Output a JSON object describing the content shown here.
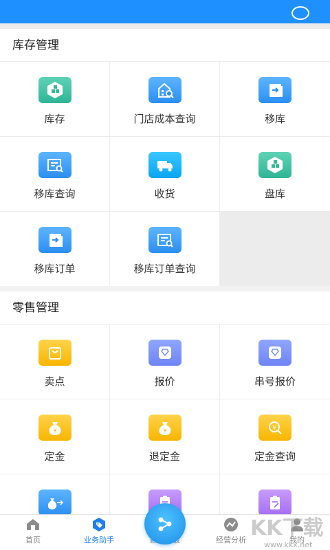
{
  "inventory": {
    "title": "库存管理",
    "items": [
      {
        "label": "库存",
        "icon": "hexagon-blocks-icon",
        "color": "#3cc1a4"
      },
      {
        "label": "门店成本查询",
        "icon": "store-search-icon",
        "color": "#3a9df5"
      },
      {
        "label": "移库",
        "icon": "transfer-doc-icon",
        "color": "#3a9df5"
      },
      {
        "label": "移库查询",
        "icon": "list-search-icon",
        "color": "#3a9df5"
      },
      {
        "label": "收货",
        "icon": "truck-icon",
        "color": "#18b0f5"
      },
      {
        "label": "盘库",
        "icon": "hexagon-blocks-icon",
        "color": "#3cc1a4"
      },
      {
        "label": "移库订单",
        "icon": "transfer-doc-icon",
        "color": "#3a9df5"
      },
      {
        "label": "移库订单查询",
        "icon": "list-search-icon",
        "color": "#3a9df5"
      }
    ]
  },
  "retail": {
    "title": "零售管理",
    "items": [
      {
        "label": "卖点",
        "icon": "shopping-bag-icon",
        "color": "#f9c21f"
      },
      {
        "label": "报价",
        "icon": "diamond-tag-icon",
        "color": "#7d93f7"
      },
      {
        "label": "串号报价",
        "icon": "diamond-tag-icon",
        "color": "#7d93f7"
      },
      {
        "label": "定金",
        "icon": "money-bag-icon",
        "color": "#f9c21f"
      },
      {
        "label": "退定金",
        "icon": "money-bag-icon",
        "color": "#f9c21f"
      },
      {
        "label": "定金查询",
        "icon": "yen-search-icon",
        "color": "#f9c21f"
      },
      {
        "label": "",
        "icon": "money-transfer-icon",
        "color": "#3a9df5"
      },
      {
        "label": "",
        "icon": "clipboard-icon",
        "color": "#b782f8"
      },
      {
        "label": "",
        "icon": "clipboard-edit-icon",
        "color": "#b782f8"
      }
    ]
  },
  "tabbar": {
    "tabs": [
      {
        "label": "首页",
        "icon": "home-icon"
      },
      {
        "label": "业务助手",
        "icon": "tag-icon",
        "active": true
      },
      {
        "label": "数据看板",
        "icon": "share-nodes-icon"
      },
      {
        "label": "经营分析",
        "icon": "trend-icon"
      },
      {
        "label": "我的",
        "icon": "person-icon"
      }
    ]
  },
  "watermark": {
    "text": "KK下载",
    "site": "www.kkx.net"
  },
  "colors": {
    "primary": "#1e90ff",
    "active_tab": "#1e7ff0"
  }
}
